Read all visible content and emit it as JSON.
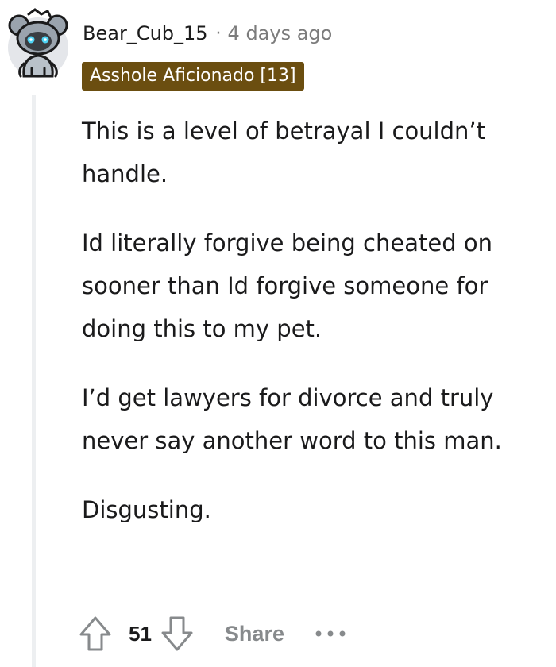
{
  "comment": {
    "author": "Bear_Cub_15",
    "separator": "·",
    "timestamp": "4 days ago",
    "flair": "Asshole Aficionado [13]",
    "paragraphs": [
      "This is a level of betrayal I couldn’t handle.",
      "Id literally forgive being cheated on sooner than Id forgive someone for doing this to my pet.",
      "I’d get lawyers for divorce and truly never say another word to this man.",
      "Disgusting."
    ],
    "score": "51",
    "share_label": "Share"
  },
  "icons": {
    "avatar": "snoo-bear-avatar-icon",
    "upvote": "upvote-arrow-icon",
    "downvote": "downvote-arrow-icon",
    "more": "more-options-icon"
  },
  "colors": {
    "flair_bg": "#6b4e10",
    "flair_text": "#ffffff",
    "meta_text": "#7c7c7c",
    "action_text": "#878a8c",
    "thread_line": "#edeff1"
  }
}
